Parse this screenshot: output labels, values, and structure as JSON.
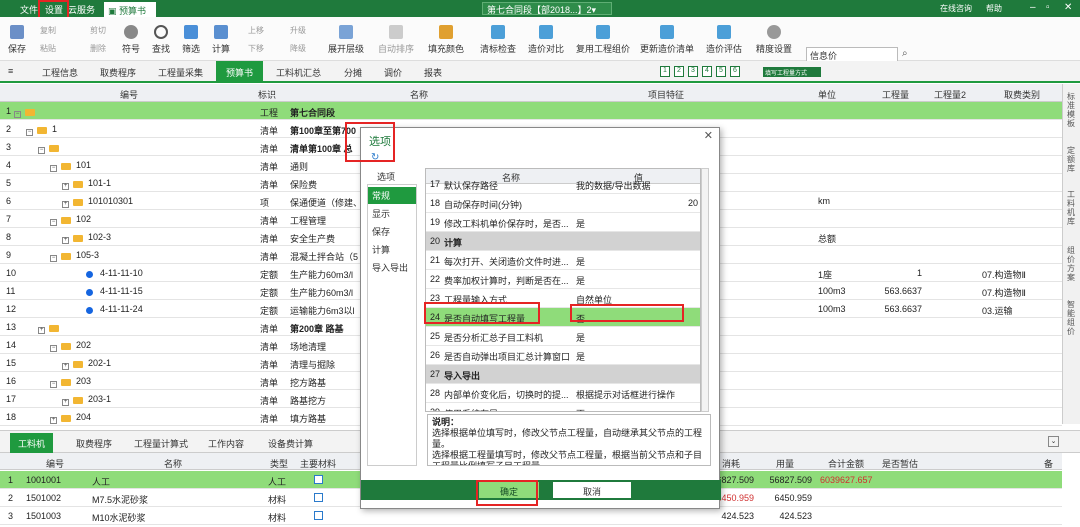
{
  "titlebar": {
    "menu_file": "文件",
    "menu_settings": "设置",
    "menu_cloud": "云服务",
    "tab_budget": "预算书",
    "doc_title": "第七合同段【部2018...】2▾",
    "search_hint": "",
    "online": "在线咨询",
    "help": "帮助"
  },
  "ribbon": {
    "save": "保存",
    "copy": "复制",
    "cut": "剪切",
    "paste": "粘贴",
    "delete": "删除",
    "symbol": "符号",
    "find": "查找",
    "filter": "筛选",
    "calc": "计算",
    "move_up": "上移",
    "move_down": "下移",
    "promote": "升级",
    "demote": "降级",
    "expand": "展开层级",
    "auto_sort": "自动排序",
    "fill_color": "填充颜色",
    "clear_check": "清标检查",
    "price_compare": "造价对比",
    "reuse_group": "复用工程组价",
    "update_budget": "更新造价清单",
    "price_eval": "造价评估",
    "precision": "精度设置",
    "info_price": "信息价"
  },
  "nav": {
    "tabs": [
      "工程信息",
      "取费程序",
      "工程量采集",
      "预算书",
      "工料机汇总",
      "分摊",
      "调价",
      "报表"
    ],
    "numbers": [
      "1",
      "2",
      "3",
      "4",
      "5",
      "6"
    ],
    "fill_mode": "填写工程量方式"
  },
  "grid": {
    "headers": {
      "code": "编号",
      "mark": "标识",
      "name": "名称",
      "feature": "项目特征",
      "unit": "单位",
      "qty": "工程量",
      "qty2": "工程量2",
      "fee": "取费类别"
    },
    "rows": [
      {
        "n": "1",
        "code": "",
        "mark": "工程",
        "name": "第七合同段",
        "unit": "",
        "qty": "",
        "fee": ""
      },
      {
        "n": "2",
        "code": "1",
        "mark": "清单",
        "name": "第100章至第700",
        "unit": "",
        "qty": "",
        "fee": ""
      },
      {
        "n": "3",
        "code": "",
        "mark": "清单",
        "name": "清单第100章 总",
        "unit": "",
        "qty": "",
        "fee": ""
      },
      {
        "n": "4",
        "code": "101",
        "mark": "清单",
        "name": "通则",
        "unit": "",
        "qty": "",
        "fee": ""
      },
      {
        "n": "5",
        "code": "101-1",
        "mark": "清单",
        "name": "保险费",
        "unit": "",
        "qty": "",
        "fee": ""
      },
      {
        "n": "6",
        "code": "101010301",
        "mark": "项",
        "name": "保通便道（修建、",
        "unit": "km",
        "qty": "",
        "fee": ""
      },
      {
        "n": "7",
        "code": "102",
        "mark": "清单",
        "name": "工程管理",
        "unit": "",
        "qty": "",
        "fee": ""
      },
      {
        "n": "8",
        "code": "102-3",
        "mark": "清单",
        "name": "安全生产费",
        "unit": "总额",
        "qty": "",
        "fee": ""
      },
      {
        "n": "9",
        "code": "105-3",
        "mark": "清单",
        "name": "混凝土拌合站（5",
        "unit": "",
        "qty": "",
        "fee": ""
      },
      {
        "n": "10",
        "code": "4-11-11-10",
        "mark": "定额",
        "name": "生产能力60m3/l",
        "unit": "1座",
        "qty": "1",
        "fee": "07.构造物Ⅱ"
      },
      {
        "n": "11",
        "code": "4-11-11-15",
        "mark": "定额",
        "name": "生产能力60m3/l",
        "unit": "100m3",
        "qty": "563.6637",
        "fee": "07.构造物Ⅱ"
      },
      {
        "n": "12",
        "code": "4-11-11-24",
        "mark": "定额",
        "name": "运输能力6m3以l",
        "unit": "100m3",
        "qty": "563.6637",
        "fee": "03.运输"
      },
      {
        "n": "13",
        "code": "",
        "mark": "清单",
        "name": "第200章 路基",
        "unit": "",
        "qty": "",
        "fee": ""
      },
      {
        "n": "14",
        "code": "202",
        "mark": "清单",
        "name": "场地清理",
        "unit": "",
        "qty": "",
        "fee": ""
      },
      {
        "n": "15",
        "code": "202-1",
        "mark": "清单",
        "name": "清理与掘除",
        "unit": "",
        "qty": "",
        "fee": ""
      },
      {
        "n": "16",
        "code": "203",
        "mark": "清单",
        "name": "挖方路基",
        "unit": "",
        "qty": "",
        "fee": ""
      },
      {
        "n": "17",
        "code": "203-1",
        "mark": "清单",
        "name": "路基挖方",
        "unit": "",
        "qty": "",
        "fee": ""
      },
      {
        "n": "18",
        "code": "204",
        "mark": "清单",
        "name": "填方路基",
        "unit": "",
        "qty": "",
        "fee": ""
      }
    ]
  },
  "sidebar": [
    "标准模板",
    "定额库",
    "工料机库",
    "组价方案",
    "智能组价"
  ],
  "bottom": {
    "tabs": [
      "工料机",
      "取费程序",
      "工程量计算式",
      "工作内容",
      "设备费计算"
    ],
    "headers": {
      "code": "编号",
      "name": "名称",
      "type": "类型",
      "main": "主要材料",
      "consume": "消耗",
      "qty": "用量",
      "total": "合计金额",
      "est": "是否暂估",
      "remark": "备"
    },
    "rows": [
      {
        "n": "1",
        "code": "1001001",
        "name": "人工",
        "type": "人工",
        "consume": "6827.509",
        "qty": "56827.509",
        "total": "6039627.657"
      },
      {
        "n": "2",
        "code": "1501002",
        "name": "M7.5水泥砂浆",
        "type": "材料",
        "consume": "6450.959",
        "qty": "6450.959",
        "total": ""
      },
      {
        "n": "3",
        "code": "1501003",
        "name": "M10水泥砂浆",
        "type": "材料",
        "consume": "424.523",
        "qty": "424.523",
        "total": ""
      }
    ]
  },
  "dialog": {
    "title": "选项",
    "nav_header": "选项",
    "nav": [
      "常规",
      "显示",
      "保存",
      "计算",
      "导入导出"
    ],
    "th_name": "名称",
    "th_value": "值",
    "rows": [
      {
        "n": "17",
        "name": "默认保存路径",
        "value": "我的数据/导出数据",
        "type": ""
      },
      {
        "n": "18",
        "name": "自动保存时间(分钟)",
        "value": "20",
        "type": "num"
      },
      {
        "n": "19",
        "name": "修改工料机单价保存时，是否...",
        "value": "是",
        "type": ""
      },
      {
        "n": "20",
        "name": "计算",
        "value": "",
        "type": "grp"
      },
      {
        "n": "21",
        "name": "每次打开、关闭造价文件时进...",
        "value": "是",
        "type": ""
      },
      {
        "n": "22",
        "name": "费率加权计算时，判断是否在...",
        "value": "是",
        "type": ""
      },
      {
        "n": "23",
        "name": "工程量输入方式",
        "value": "自然单位",
        "type": ""
      },
      {
        "n": "24",
        "name": "是否自动填写工程量",
        "value": "否",
        "type": "hl"
      },
      {
        "n": "25",
        "name": "是否分析汇总子目工料机",
        "value": "是",
        "type": ""
      },
      {
        "n": "26",
        "name": "是否自动弹出项目汇总计算窗口",
        "value": "是",
        "type": ""
      },
      {
        "n": "27",
        "name": "导入导出",
        "value": "",
        "type": "grp"
      },
      {
        "n": "28",
        "name": "内部单价变化后，切换时的提...",
        "value": "根据提示对话框进行操作",
        "type": ""
      },
      {
        "n": "29",
        "name": "使用系统布局",
        "value": "否",
        "type": ""
      }
    ],
    "desc_title": "说明：",
    "desc1": "选择根据单位填写时，修改父节点工程量，自动继承其父节点的工程量。",
    "desc2": "选择根据工程量填写时，修改父节点工程量，根据当前父节点和子目工程量比例填写子目工程量",
    "ok": "确定",
    "cancel": "取消"
  }
}
